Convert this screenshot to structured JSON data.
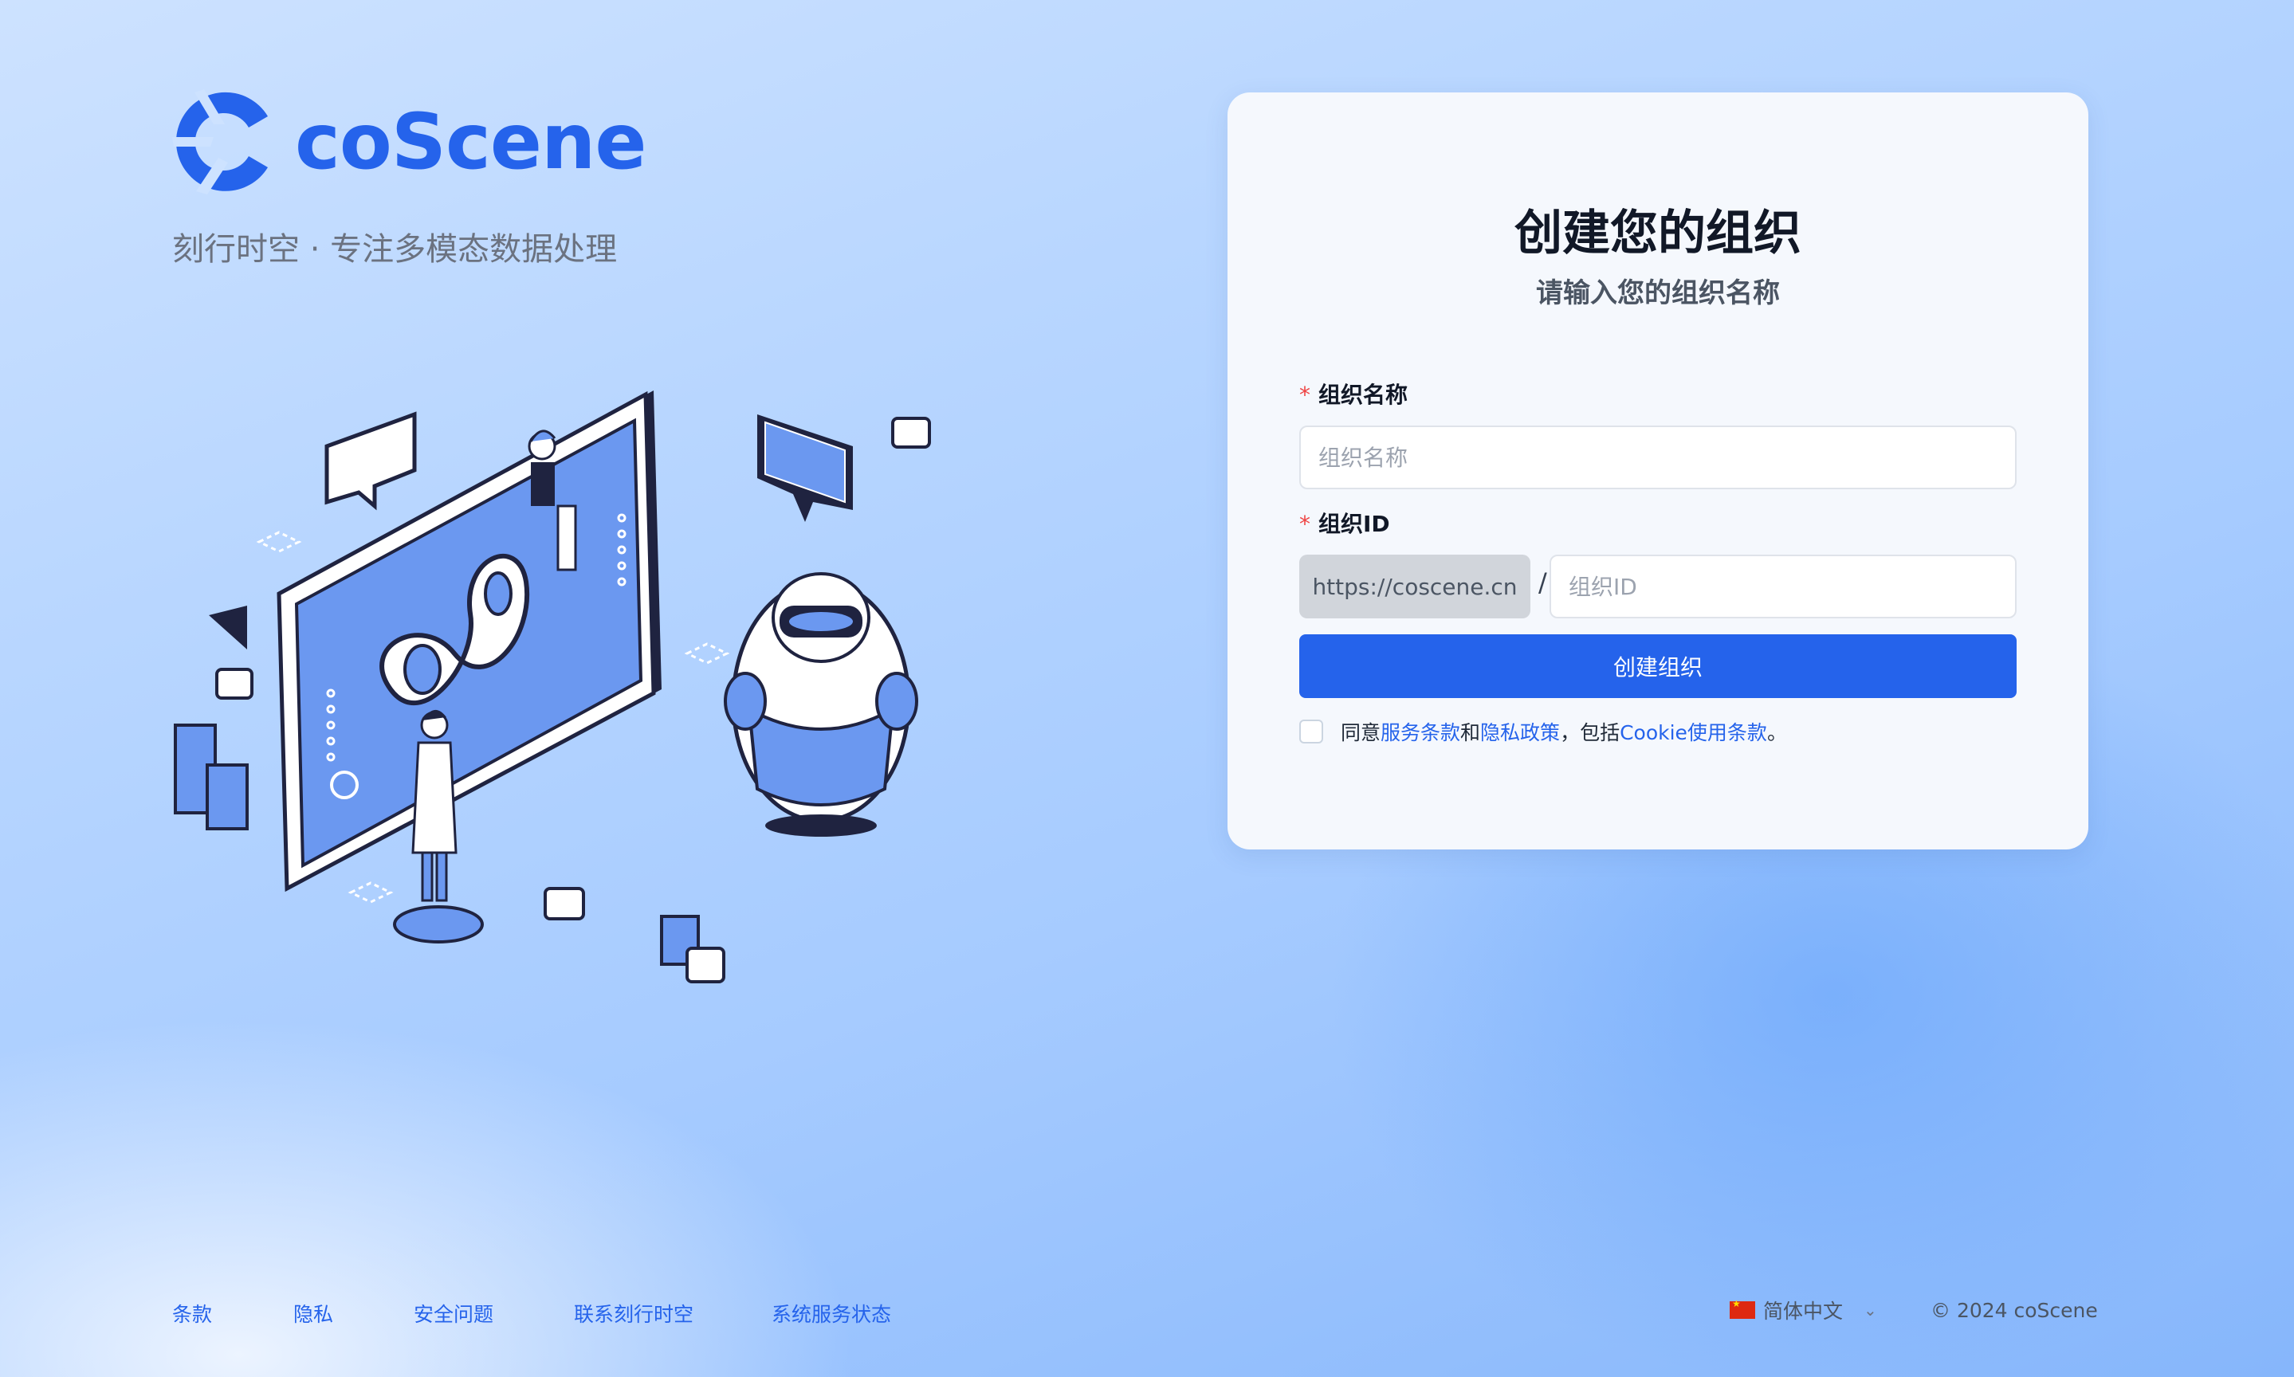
{
  "brand": {
    "name": "coScene",
    "slogan": "刻行时空 · 专注多模态数据处理",
    "color": "#2563eb"
  },
  "card": {
    "title": "创建您的组织",
    "subtitle": "请输入您的组织名称",
    "org_name": {
      "required_mark": "*",
      "label": "组织名称",
      "placeholder": "组织名称",
      "value": ""
    },
    "org_id": {
      "required_mark": "*",
      "label": "组织ID",
      "prefix": "https://coscene.cn",
      "separator": "/",
      "placeholder": "组织ID",
      "value": ""
    },
    "submit_label": "创建组织",
    "agreement": {
      "checked": false,
      "prefix": "同意",
      "terms_link": "服务条款",
      "and": "和",
      "privacy_link": "隐私政策",
      "comma_include": "，包括",
      "cookie_link": "Cookie使用条款",
      "suffix": "。"
    }
  },
  "footer": {
    "links": [
      "条款",
      "隐私",
      "安全问题",
      "联系刻行时空",
      "系统服务状态"
    ],
    "language": "简体中文",
    "copyright": "© 2024 coScene"
  },
  "colors": {
    "primary": "#2563eb",
    "required": "#ef4444",
    "card_bg": "#f5f8fd"
  },
  "icons": {
    "logo": "coscene-logo-icon",
    "flag": "china-flag-icon",
    "dropdown": "chevron-down-icon"
  }
}
